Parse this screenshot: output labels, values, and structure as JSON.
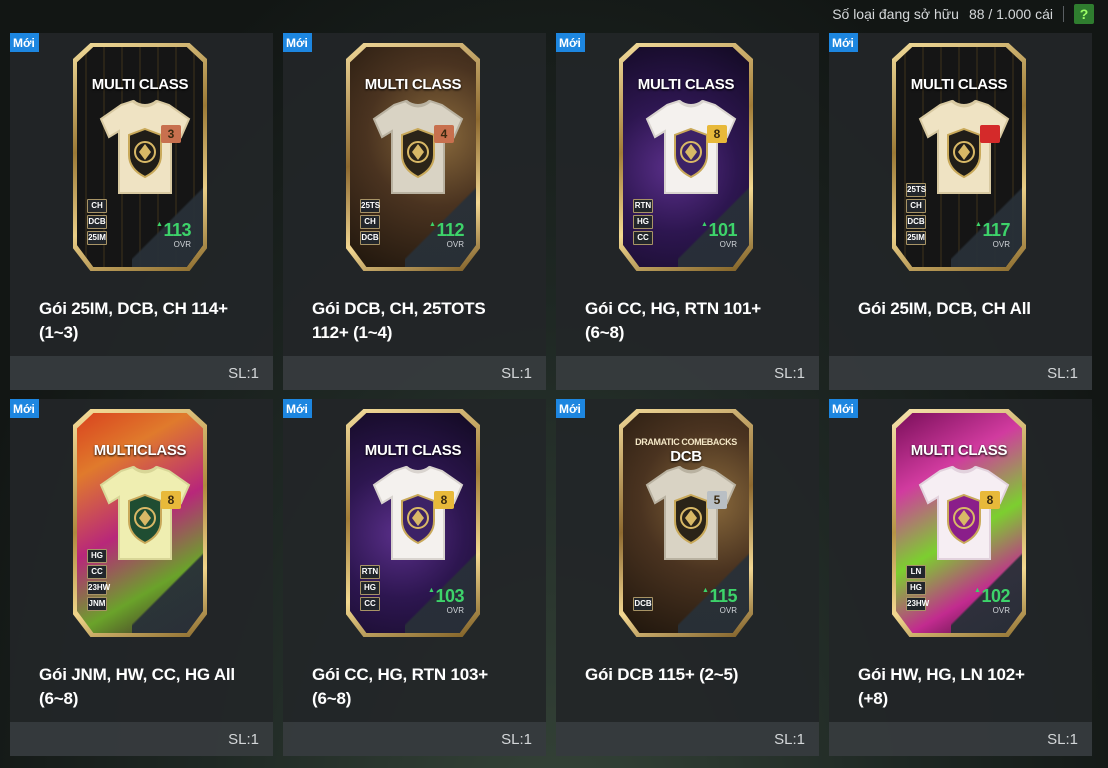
{
  "header": {
    "owned_label": "Số loại đang sở hữu",
    "owned_value": "88 / 1.000 cái",
    "help_label": "?"
  },
  "packs": [
    {
      "badge": "Mới",
      "card_title": "MULTI CLASS",
      "card_subtitle": "",
      "rank": "3",
      "rank_color": "#c8704e",
      "chips": [
        "CH",
        "DCB",
        "25IM"
      ],
      "ovr": "113",
      "ovr_label": "OVR",
      "theme": "black-gold",
      "name_lines": [
        "Gói 25IM, DCB, CH 114+",
        "(1~3)"
      ],
      "quantity": "SL:1"
    },
    {
      "badge": "Mới",
      "card_title": "MULTI CLASS",
      "card_subtitle": "",
      "rank": "4",
      "rank_color": "#c8704e",
      "chips": [
        "25TS",
        "CH",
        "DCB"
      ],
      "ovr": "112",
      "ovr_label": "OVR",
      "theme": "bronze-ornate",
      "name_lines": [
        "Gói DCB, CH, 25TOTS",
        "112+ (1~4)"
      ],
      "quantity": "SL:1"
    },
    {
      "badge": "Mới",
      "card_title": "MULTI CLASS",
      "card_subtitle": "",
      "rank": "8",
      "rank_color": "#e8b93a",
      "chips": [
        "RTN",
        "HG",
        "CC"
      ],
      "ovr": "101",
      "ovr_label": "OVR",
      "theme": "purple-gold",
      "name_lines": [
        "Gói CC, HG, RTN 101+",
        "(6~8)"
      ],
      "quantity": "SL:1"
    },
    {
      "badge": "Mới",
      "card_title": "MULTI CLASS",
      "card_subtitle": "",
      "rank": "",
      "rank_color": "#d42a2a",
      "chips": [
        "25TS",
        "CH",
        "DCB",
        "25IM"
      ],
      "ovr": "117",
      "ovr_label": "OVR",
      "theme": "black-gold",
      "name_lines": [
        "Gói 25IM, DCB, CH All"
      ],
      "quantity": "SL:1"
    },
    {
      "badge": "Mới",
      "card_title": "MULTICLASS",
      "card_subtitle": "",
      "rank": "8",
      "rank_color": "#e8b93a",
      "chips": [
        "HG",
        "CC",
        "23HW",
        "JNM"
      ],
      "ovr": "",
      "ovr_label": "",
      "theme": "pink-green",
      "name_lines": [
        "Gói JNM, HW, CC, HG All",
        "(6~8)"
      ],
      "quantity": "SL:1"
    },
    {
      "badge": "Mới",
      "card_title": "MULTI CLASS",
      "card_subtitle": "",
      "rank": "8",
      "rank_color": "#e8b93a",
      "chips": [
        "RTN",
        "HG",
        "CC"
      ],
      "ovr": "103",
      "ovr_label": "OVR",
      "theme": "purple-gold",
      "name_lines": [
        "Gói CC, HG, RTN 103+",
        "(6~8)"
      ],
      "quantity": "SL:1"
    },
    {
      "badge": "Mới",
      "card_title": "DCB",
      "card_subtitle": "DRAMATIC COMEBACKS",
      "rank": "5",
      "rank_color": "#b9bfc4",
      "chips": [
        "DCB"
      ],
      "ovr": "115",
      "ovr_label": "OVR",
      "theme": "bronze-ornate",
      "name_lines": [
        "Gói DCB 115+ (2~5)"
      ],
      "quantity": "SL:1"
    },
    {
      "badge": "Mới",
      "card_title": "MULTI CLASS",
      "card_subtitle": "",
      "rank": "8",
      "rank_color": "#e8b93a",
      "chips": [
        "LN",
        "HG",
        "23HW"
      ],
      "ovr": "102",
      "ovr_label": "OVR",
      "theme": "neon-pink",
      "name_lines": [
        "Gói HW, HG, LN 102+",
        "(+8)"
      ],
      "quantity": "SL:1"
    }
  ]
}
